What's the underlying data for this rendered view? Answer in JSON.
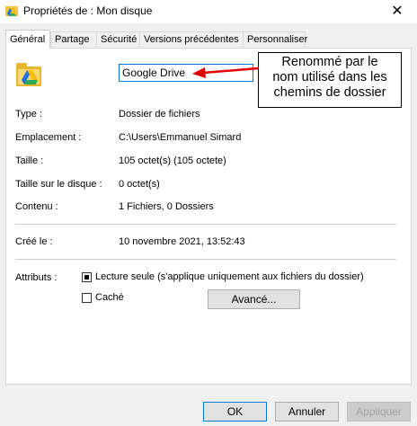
{
  "window": {
    "title": "Propriétés de : Mon disque",
    "close_glyph": "✕"
  },
  "tabs": [
    {
      "label": "Général",
      "active": true
    },
    {
      "label": "Partage"
    },
    {
      "label": "Sécurité"
    },
    {
      "label": "Versions précédentes"
    },
    {
      "label": "Personnaliser"
    }
  ],
  "general": {
    "name_value": "Google Drive",
    "callout": "Renommé par le\nnom utilisé dans les\nchemins de dossier",
    "rows": [
      {
        "label": "Type :",
        "value": "Dossier de fichiers"
      },
      {
        "label": "Emplacement :",
        "value": "C:\\Users\\Emmanuel Simard"
      },
      {
        "label": "Taille :",
        "value": "105 octet(s) (105 octete)"
      },
      {
        "label": "Taille sur le disque :",
        "value": "0 octet(s)"
      },
      {
        "label": "Contenu :",
        "value": "1 Fichiers, 0 Dossiers"
      },
      {
        "label": "Créé le :",
        "value": "10 novembre 2021, 13:52:43"
      }
    ],
    "attributes_label": "Attributs :",
    "readonly_label": "Lecture seule (s'applique uniquement aux fichiers du dossier)",
    "readonly_checked": true,
    "hidden_label": "Caché",
    "hidden_checked": false,
    "advanced_button": "Avancé..."
  },
  "footer": {
    "ok": "OK",
    "cancel": "Annuler",
    "apply": "Appliquer"
  },
  "colors": {
    "accent": "#0078d7",
    "arrow": "#e00000"
  }
}
